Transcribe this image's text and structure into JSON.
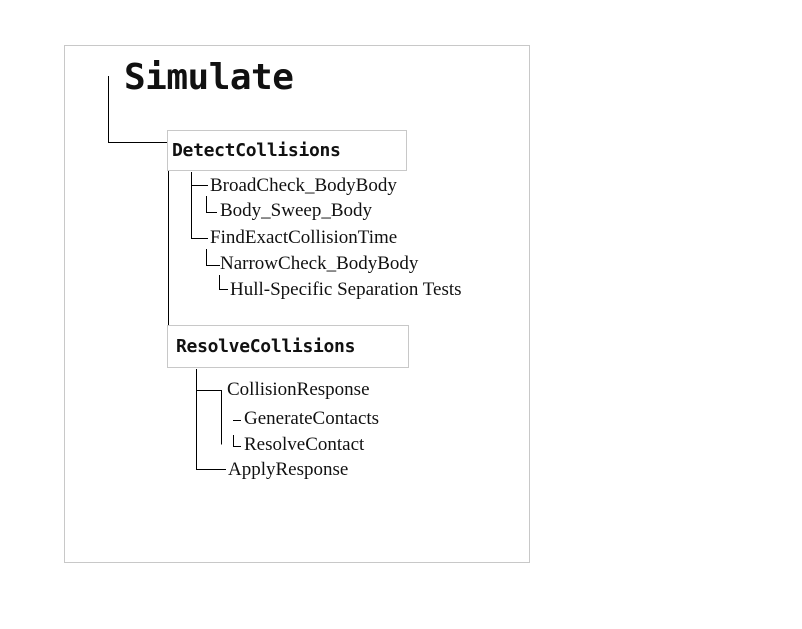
{
  "title": "Simulate",
  "detect": {
    "label": "DetectCollisions",
    "children": {
      "broad_check": "BroadCheck_BodyBody",
      "body_sweep": "Body_Sweep_Body",
      "find_exact": "FindExactCollisionTime",
      "narrow_check": "NarrowCheck_BodyBody",
      "hull_tests": "Hull-Specific Separation Tests"
    }
  },
  "resolve": {
    "label": "ResolveCollisions",
    "children": {
      "collision_response": "CollisionResponse",
      "generate_contacts": "GenerateContacts",
      "resolve_contact": "ResolveContact",
      "apply_response": "ApplyResponse"
    }
  }
}
